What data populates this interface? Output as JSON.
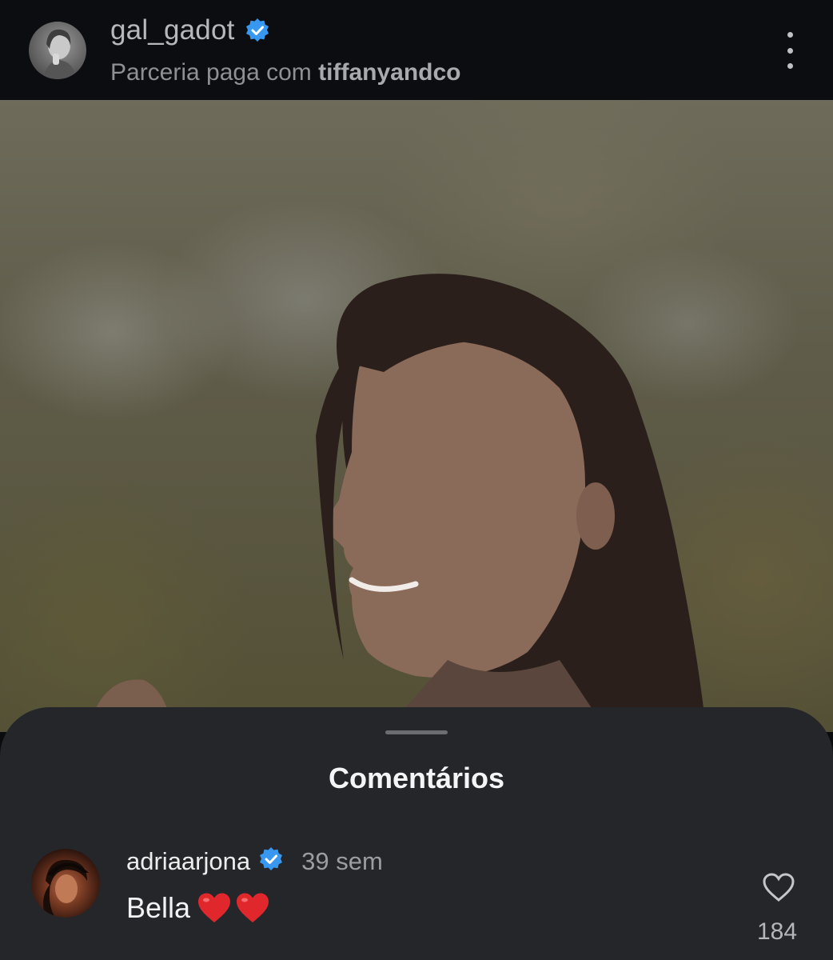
{
  "post_header": {
    "username": "gal_gadot",
    "partnership_prefix": "Parceria paga com ",
    "partner": "tiffanyandco"
  },
  "comments_sheet": {
    "title": "Comentários",
    "comments": [
      {
        "username": "adriaarjona",
        "time": "39 sem",
        "text": "Bella",
        "emojis": [
          "red-heart",
          "red-heart"
        ],
        "likes": "184"
      }
    ]
  },
  "colors": {
    "verified_badge": "#3897f0",
    "heart_emoji": "#e0282c",
    "sheet_background": "#24262a",
    "header_background": "#0c0d10"
  }
}
